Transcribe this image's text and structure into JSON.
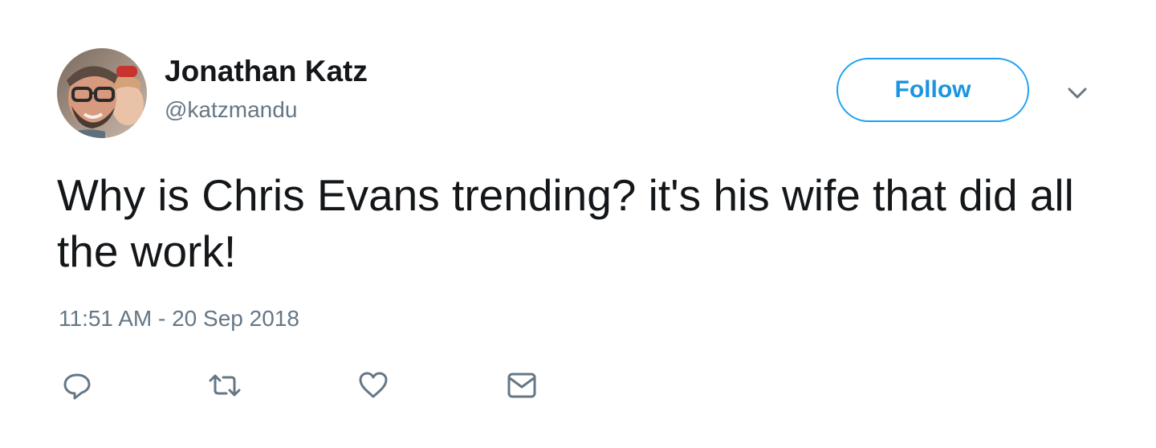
{
  "tweet": {
    "author": {
      "display_name": "Jonathan Katz",
      "handle": "@katzmandu"
    },
    "follow_label": "Follow",
    "text": "Why is Chris Evans trending? it's his wife that did all the work!",
    "timestamp": "11:51 AM - 20 Sep 2018"
  },
  "icons": {
    "more": "chevron-down-icon",
    "actions": [
      "reply-icon",
      "retweet-icon",
      "like-icon",
      "direct-message-icon"
    ]
  },
  "colors": {
    "accent": "#1da1f2",
    "text_primary": "#14171a",
    "text_secondary": "#657786"
  }
}
